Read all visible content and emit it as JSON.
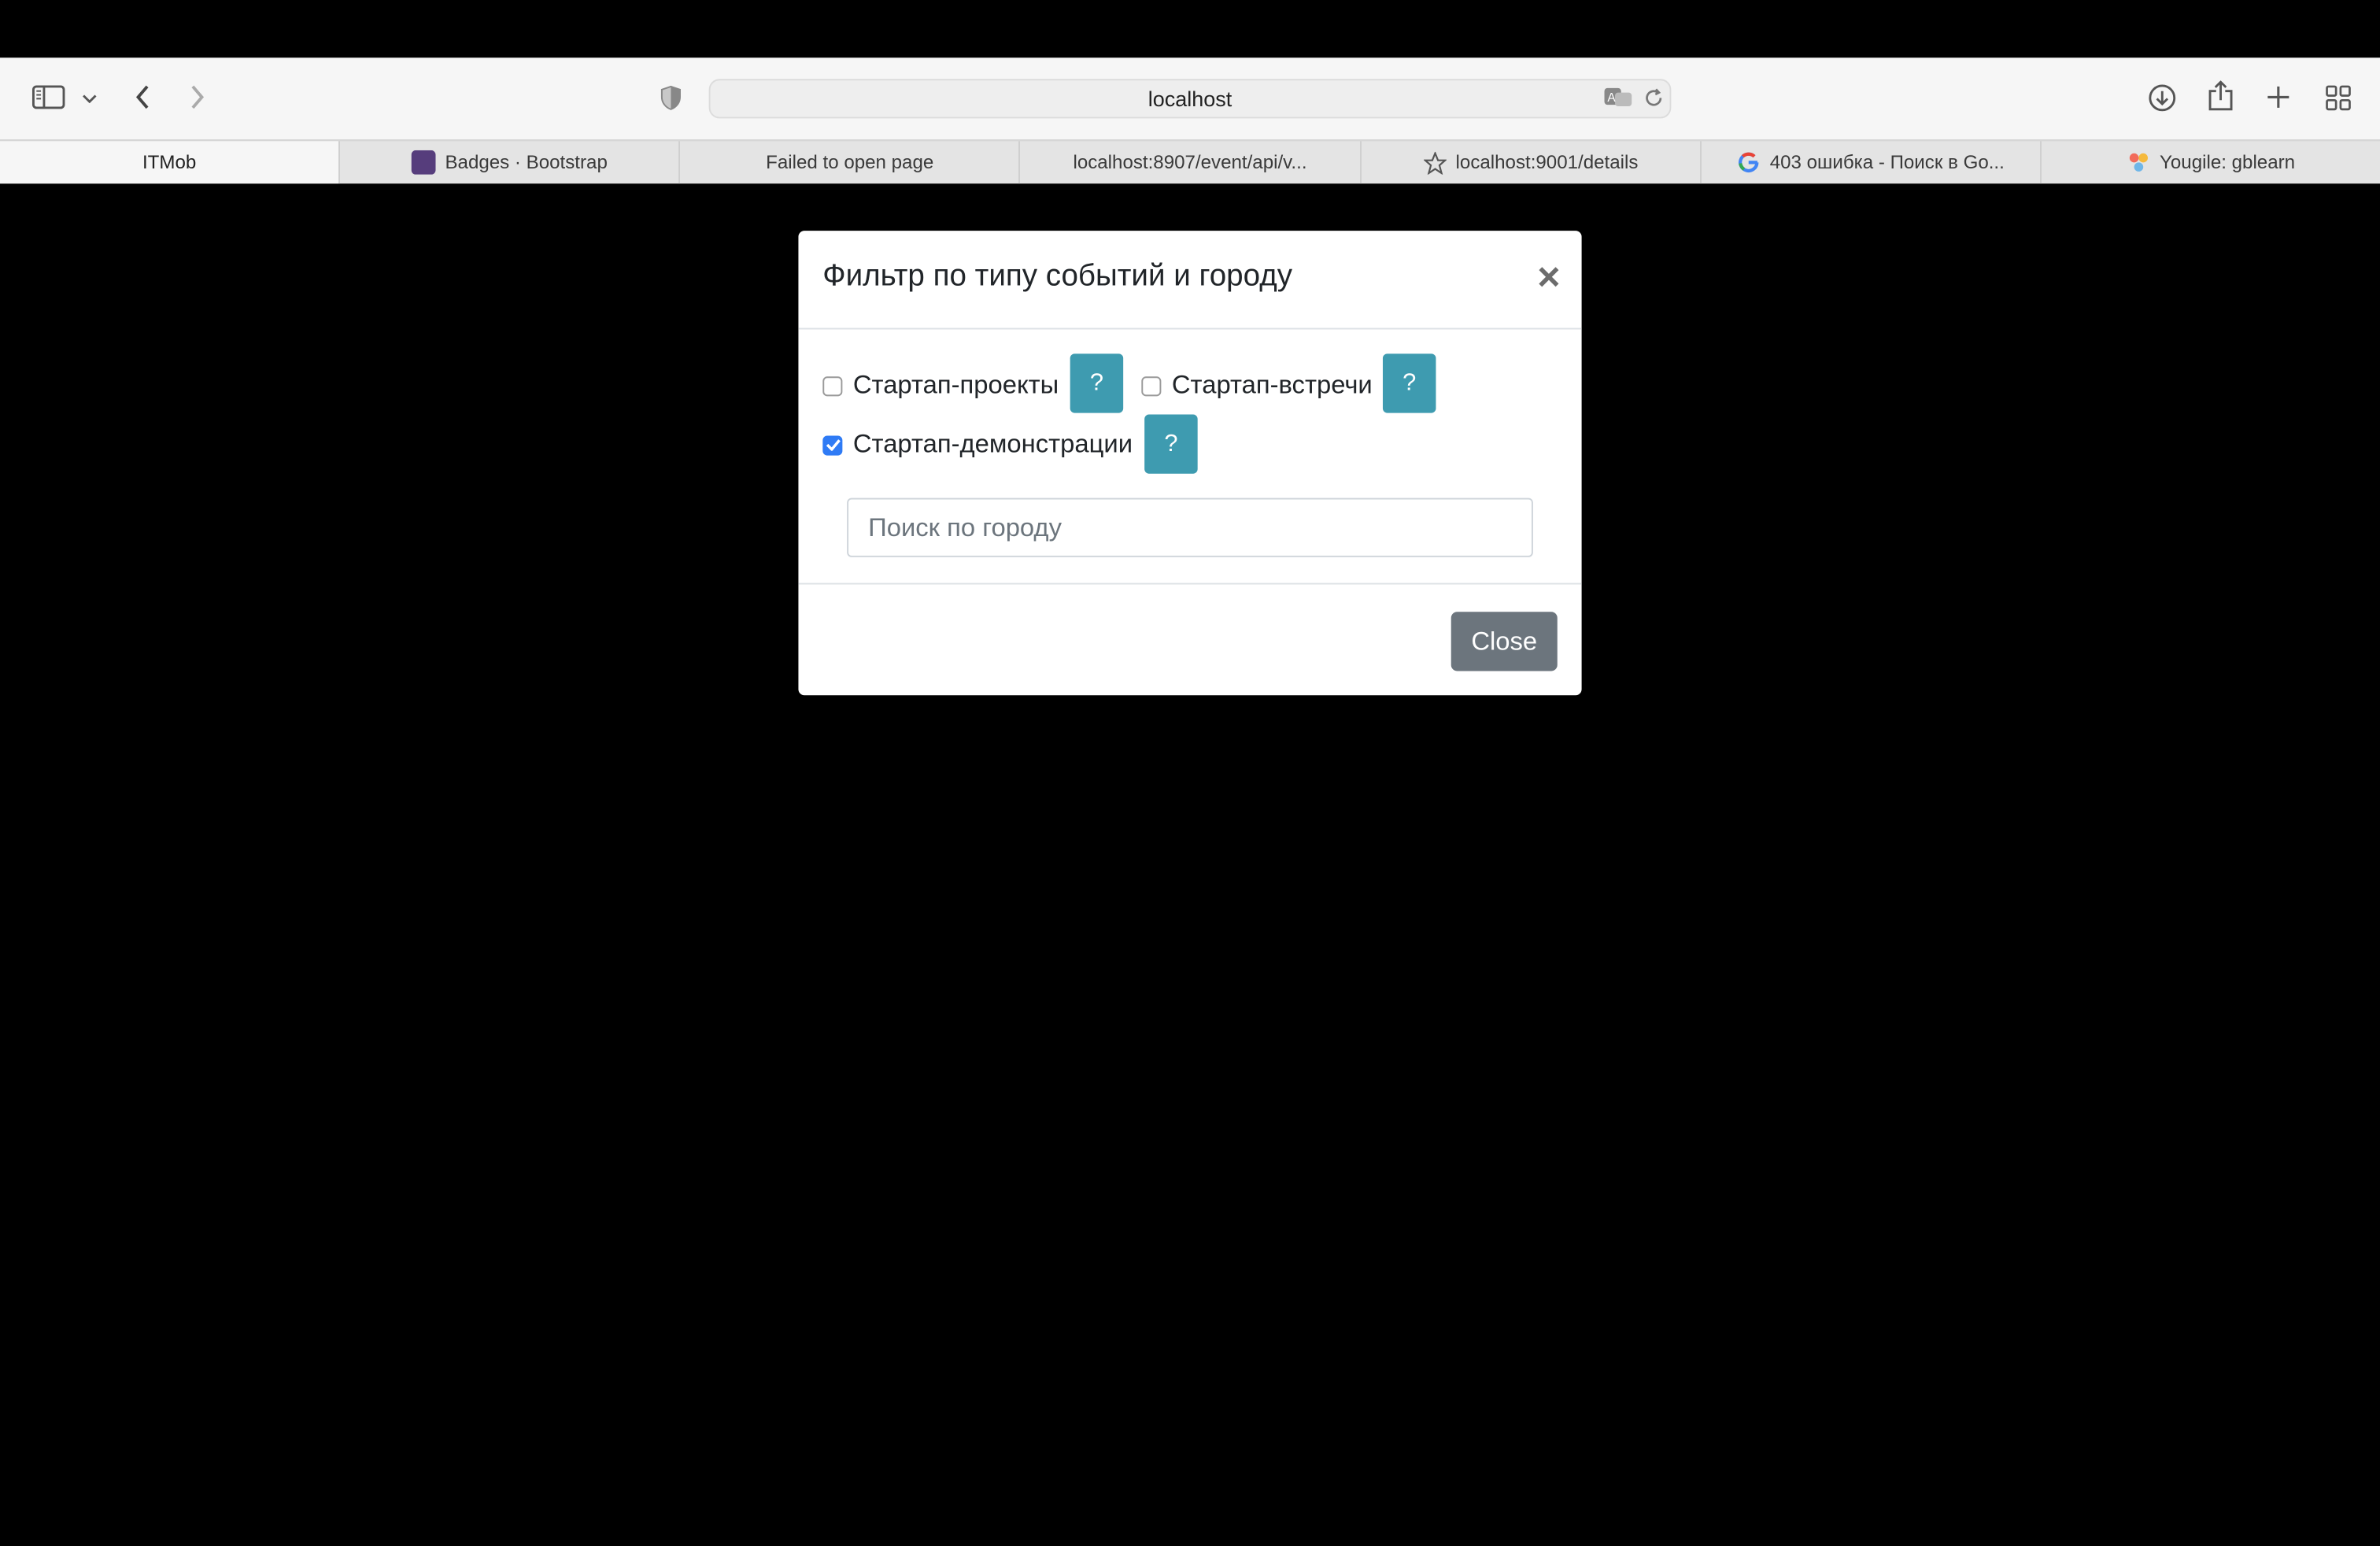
{
  "browser": {
    "url": "localhost",
    "tabs": [
      {
        "title": "ITMob",
        "icon": ""
      },
      {
        "title": "Badges · Bootstrap",
        "icon": "bootstrap-favicon"
      },
      {
        "title": "Failed to open page",
        "icon": ""
      },
      {
        "title": "localhost:8907/event/api/v...",
        "icon": ""
      },
      {
        "title": "localhost:9001/details",
        "icon": "star-icon"
      },
      {
        "title": "403 ошибка - Поиск в Go...",
        "icon": "google-favicon"
      },
      {
        "title": "Yougile: gblearn",
        "icon": "yougile-favicon"
      }
    ]
  },
  "modal": {
    "title": "Фильтр по типу событий и городу",
    "close_glyph": "×",
    "filters": [
      {
        "label": "Стартап-проекты",
        "checked": false,
        "help": "?"
      },
      {
        "label": "Стартап-встречи",
        "checked": false,
        "help": "?"
      },
      {
        "label": "Стартап-демонстрации",
        "checked": true,
        "help": "?"
      }
    ],
    "search_placeholder": "Поиск по городу",
    "close_button": "Close"
  },
  "colors": {
    "help_button": "#3e9bb0",
    "close_button": "#6c757d",
    "checkbox_checked": "#2f7bf5"
  }
}
